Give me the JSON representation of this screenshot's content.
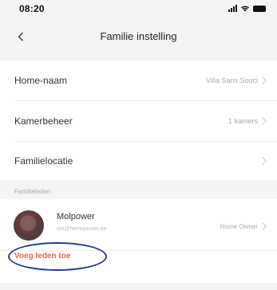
{
  "status_bar": {
    "time": "08:20"
  },
  "nav": {
    "title": "Familie instelling"
  },
  "settings": {
    "home_name": {
      "label": "Home-naam",
      "value": "Villa Sans Souci"
    },
    "room_management": {
      "label": "Kamerbeheer",
      "value": "1 kamers"
    },
    "family_location": {
      "label": "Familielocatie",
      "value": ""
    }
  },
  "members": {
    "section_title": "Familieleden",
    "list": [
      {
        "name": "Molpower",
        "subtitle": "sm@hemopower.be",
        "role": "Home Owner"
      }
    ],
    "add_label": "Voeg leden toe"
  },
  "colors": {
    "accent": "#e8684a",
    "highlight": "#1f3f8a",
    "background": "#f4f4f6"
  }
}
